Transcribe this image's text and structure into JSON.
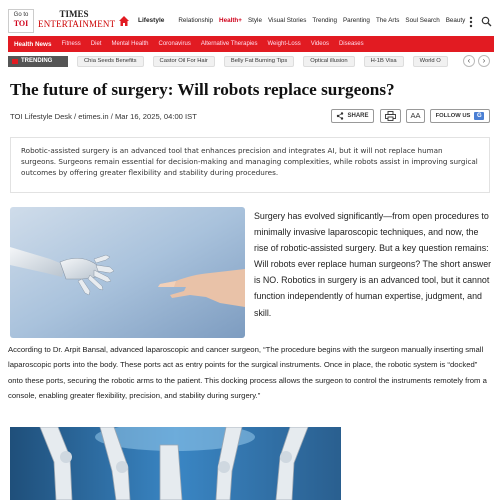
{
  "header": {
    "goto_label": "Go to",
    "goto_brand": "TOI",
    "logo_line1": "TIMES",
    "logo_line2": "ENTERTAINMENT",
    "nav_items": [
      "Lifestyle",
      "Relationship",
      "Health+",
      "Style",
      "Visual Stories",
      "Trending",
      "Parenting",
      "The Arts",
      "Soul Search",
      "Beauty"
    ],
    "icons": [
      "home-icon",
      "kebab-menu-icon",
      "search-icon"
    ],
    "accent_color": "#e21b22"
  },
  "section_bar": {
    "items": [
      "Health News",
      "Fitness",
      "Diet",
      "Mental Health",
      "Coronavirus",
      "Alternative Therapies",
      "Weight-Loss",
      "Videos",
      "Diseases"
    ]
  },
  "trending": {
    "badge": "TRENDING",
    "items": [
      "Chia Seeds Benefits",
      "Castor Oil For Hair",
      "Belly Fat Burning Tips",
      "Optical illusion",
      "H-1B Visa",
      "World O"
    ]
  },
  "article": {
    "title": "The future of surgery: Will robots replace surgeons?",
    "byline": "TOI Lifestyle Desk / etimes.in / Mar 16, 2025, 04:00 IST",
    "share_label": "SHARE",
    "font_label": "AA",
    "follow_label": "FOLLOW US",
    "summary": "Robotic-assisted surgery is an advanced tool that enhances precision and integrates AI, but it will not replace human surgeons. Surgeons remain essential for decision-making and managing complexities, while robots assist in improving surgical outcomes by offering greater flexibility and stability during procedures.",
    "para1": "Surgery has evolved significantly—from open procedures to minimally invasive laparoscopic techniques, and now, the rise of robotic-assisted surgery. But a key question remains: Will robots ever replace human surgeons? The short answer is NO. Robotics in surgery is an advanced tool, but it cannot function independently of human expertise, judgment, and skill.",
    "para2": "According to Dr. Arpit Bansal, advanced laparoscopic and cancer surgeon, “The procedure begins with the surgeon manually inserting small laparoscopic ports into the body. These ports act as entry points for the surgical instruments. Once in place, the robotic system is “docked” onto these ports, securing the robotic arms to the patient. This docking process allows the surgeon to control the instruments remotely from a console, enabling greater flexibility, precision, and stability during surgery.”"
  }
}
